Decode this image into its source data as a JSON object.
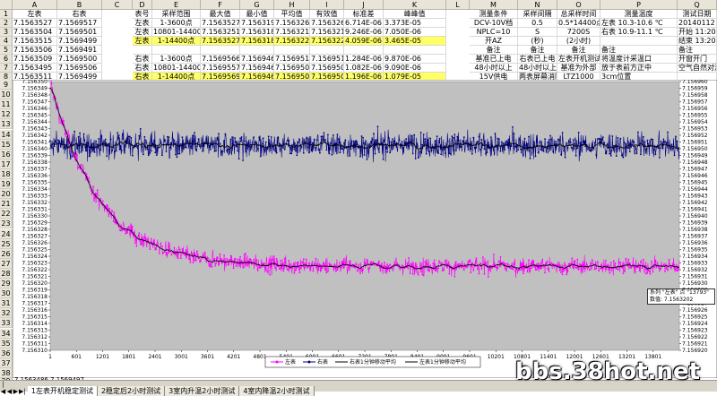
{
  "columns": [
    "A",
    "B",
    "C",
    "D",
    "E",
    "F",
    "G",
    "H",
    "I",
    "J",
    "K",
    "L",
    "M",
    "N",
    "O",
    "P",
    "Q"
  ],
  "rows": [
    "1",
    "2",
    "3",
    "4",
    "5",
    "6",
    "7",
    "8",
    "9",
    "10",
    "11",
    "12",
    "13",
    "14",
    "15",
    "16",
    "17",
    "18",
    "19",
    "20",
    "21",
    "22",
    "23",
    "24",
    "25",
    "26",
    "27",
    "28",
    "29",
    "30",
    "31",
    "32",
    "33",
    "34",
    "35",
    "36",
    "37",
    "38",
    "39",
    "40"
  ],
  "header": {
    "a": "左表",
    "b": "右表",
    "d": "表号",
    "e": "采样范围",
    "f": "最大值",
    "g": "最小值",
    "h": "平均值",
    "i": "有效值",
    "j": "标准差",
    "k": "峰峰值",
    "m": "测量条件",
    "n": "采样间隔",
    "o": "总采样时间",
    "p": "测量温度",
    "q": "测试日期"
  },
  "data_rows": [
    {
      "a": "7.1563527",
      "b": "7.1569517",
      "d": "左表",
      "e": "1-3600点",
      "f": "7.1563527",
      "g": "7.1563190",
      "h": "7.1563264",
      "i": "7.1563264",
      "j": "6.714E-06",
      "k": "3.373E-05",
      "m": "DCV-10V档",
      "n": "0.5",
      "o": "0.5*14400点",
      "p": "左表 10.3-10.6 ℃",
      "q": "20140112"
    },
    {
      "a": "7.1563504",
      "b": "7.1569501",
      "d": "左表",
      "e": "10801-14400点",
      "f": "7.1563251",
      "g": "7.1563181",
      "h": "7.1563214",
      "i": "7.1563214",
      "j": "9.246E-06",
      "k": "7.050E-06",
      "m": "NPLC=10",
      "n": "S",
      "o": "7200S",
      "p": "右表 10.9-11.1 ℃",
      "q": "开始 11:20"
    },
    {
      "a": "7.1563515",
      "b": "7.1569499",
      "d": "左表",
      "e": "1-14400点",
      "f": "7.1563527",
      "g": "7.1563181",
      "h": "7.1563227",
      "i": "7.1563227",
      "j": "4.059E-06",
      "k": "3.465E-05",
      "m": "开AZ",
      "n": "(秒)",
      "o": "(2小时)",
      "p": "",
      "q": "结束 13:20"
    },
    {
      "a": "7.1563506",
      "b": "7.1569491",
      "d": "",
      "e": "",
      "f": "",
      "g": "",
      "h": "",
      "i": "",
      "j": "",
      "k": "",
      "m": "备注",
      "n": "备注",
      "o": "备注",
      "p": "备注",
      "q": "备注"
    },
    {
      "a": "7.1563509",
      "b": "7.1569500",
      "d": "右表",
      "e": "1-3600点",
      "f": "7.1569566",
      "g": "7.1569467",
      "h": "7.1569514",
      "i": "7.1569514",
      "j": "1.284E-06",
      "k": "9.870E-06",
      "m": "基准已上电",
      "n": "右表已上电",
      "o": "左表开机测试",
      "p": "将温度计采温口",
      "q": "开窗开门"
    },
    {
      "a": "7.1563495",
      "b": "7.1569506",
      "d": "右表",
      "e": "10801-14400点",
      "f": "7.1569557",
      "g": "7.1569466",
      "h": "7.1569506",
      "i": "7.1569506",
      "j": "1.082E-06",
      "k": "9.090E-06",
      "m": "48小时以上",
      "n": "48小时以上",
      "o": "基准为外部",
      "p": "放于表前方正中",
      "q": "空气自然对流"
    },
    {
      "a": "7.1563511",
      "b": "7.1569499",
      "d": "右表",
      "e": "1-14400点",
      "f": "7.1569569",
      "g": "7.1569461",
      "h": "7.1569508",
      "i": "7.1569508",
      "j": "1.196E-06",
      "k": "1.079E-05",
      "m": "15V供电",
      "n": "两表屏幕消隐",
      "o": "LTZ1000",
      "p": "3cm位置",
      "q": ""
    }
  ],
  "bottom_rows": [
    {
      "a": "7.1563486",
      "b": "7.1569497"
    },
    {
      "a": "7.1563494",
      "b": "7.1569495"
    }
  ],
  "sheet_tabs": [
    "1左表开机稳定测试",
    "2稳定后2小时测试",
    "3室内升温2小时测试",
    "4室内降温2小时测试"
  ],
  "tooltip": {
    "line1": "系列 \"左表\" 点 \"13793\"",
    "line2": "数值: 7.1563202"
  },
  "watermark": "bbs.38hot.net",
  "colors": {
    "left_series": "#ff00ff",
    "right_series": "#000080",
    "plot_bg": "#c0c0c0",
    "highlight": "#ffff66"
  },
  "chart_data": {
    "type": "line",
    "x_tick_labels": [
      "1",
      "601",
      "1201",
      "1801",
      "2401",
      "3001",
      "3601",
      "4201",
      "4801",
      "5401",
      "6001",
      "6601",
      "7201",
      "7801",
      "8401",
      "9001",
      "9601",
      "10201",
      "10801",
      "11401",
      "12001",
      "12601",
      "13201",
      "13801"
    ],
    "x_range": [
      1,
      14400
    ],
    "left_axis": {
      "min": 7.15631,
      "max": 7.15635,
      "tick_labels": [
        "7.156350",
        "7.156349",
        "7.156348",
        "7.156347",
        "7.156346",
        "7.156345",
        "7.156344",
        "7.156343",
        "7.156342",
        "7.156341",
        "7.156340",
        "7.156339",
        "7.156338",
        "7.156337",
        "7.156336",
        "7.156335",
        "7.156334",
        "7.156333",
        "7.156332",
        "7.156331",
        "7.156330",
        "7.156329",
        "7.156328",
        "7.156327",
        "7.156326",
        "7.156325",
        "7.156324",
        "7.156323",
        "7.156322",
        "7.156321",
        "7.156320",
        "7.156319",
        "7.156318",
        "7.156317",
        "7.156316",
        "7.156315",
        "7.156314",
        "7.156313",
        "7.156312",
        "7.156311",
        "7.156310"
      ]
    },
    "right_axis": {
      "min": 7.15692,
      "max": 7.15696,
      "tick_labels": [
        "7.156960",
        "7.156959",
        "7.156958",
        "7.156957",
        "7.156956",
        "7.156955",
        "7.156954",
        "7.156953",
        "7.156952",
        "7.156951",
        "7.156950",
        "7.156949",
        "7.156948",
        "7.156947",
        "7.156946",
        "7.156945",
        "7.156944",
        "7.156943",
        "7.156942",
        "7.156941",
        "7.156940",
        "7.156939",
        "7.156938",
        "7.156937",
        "7.156936",
        "7.156935",
        "7.156934",
        "7.156933",
        "7.156932",
        "7.156931",
        "7.156930",
        "7.156929",
        "7.156928",
        "7.156927",
        "7.156926",
        "7.156925",
        "7.156924",
        "7.156923",
        "7.156922",
        "7.156921",
        "7.156920"
      ]
    },
    "series": [
      {
        "name": "左表",
        "axis": "left",
        "color": "#ff00ff",
        "start": 7.15635,
        "settle": 7.1563225,
        "tau": 1100,
        "noise": 1.2e-06
      },
      {
        "name": "右表",
        "axis": "right",
        "color": "#000080",
        "level": 7.1569505,
        "noise": 1.5e-06
      },
      {
        "name": "右表1分钟移动平均",
        "axis": "right",
        "color": "#000000"
      },
      {
        "name": "左表1分钟移动平均",
        "axis": "left",
        "color": "#000000"
      }
    ],
    "legend": [
      "左表",
      "右表",
      "右表1分钟移动平均",
      "左表1分钟移动平均"
    ],
    "legend_position": "bottom",
    "grid": true
  }
}
